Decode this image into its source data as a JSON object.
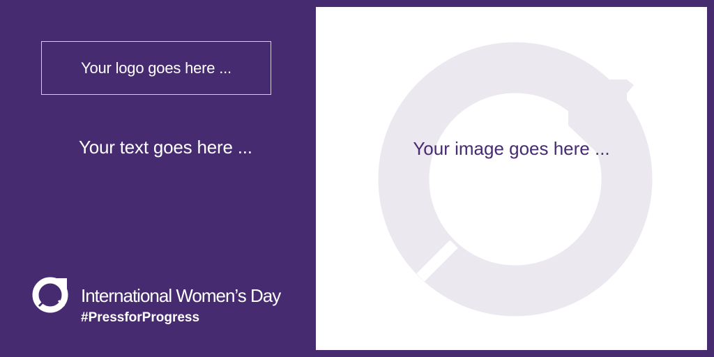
{
  "logo_placeholder": "Your logo goes here ...",
  "text_placeholder": "Your text goes here ...",
  "image_placeholder": "Your image goes here ...",
  "footer": {
    "icon": "iwd-symbol-icon",
    "title": "International Women’s Day",
    "hashtag": "#PressforProgress"
  },
  "colors": {
    "background": "#472b70",
    "panel": "#ffffff",
    "watermark": "#ebe8f0",
    "text_light": "#ffffff",
    "text_dark": "#472b70"
  }
}
